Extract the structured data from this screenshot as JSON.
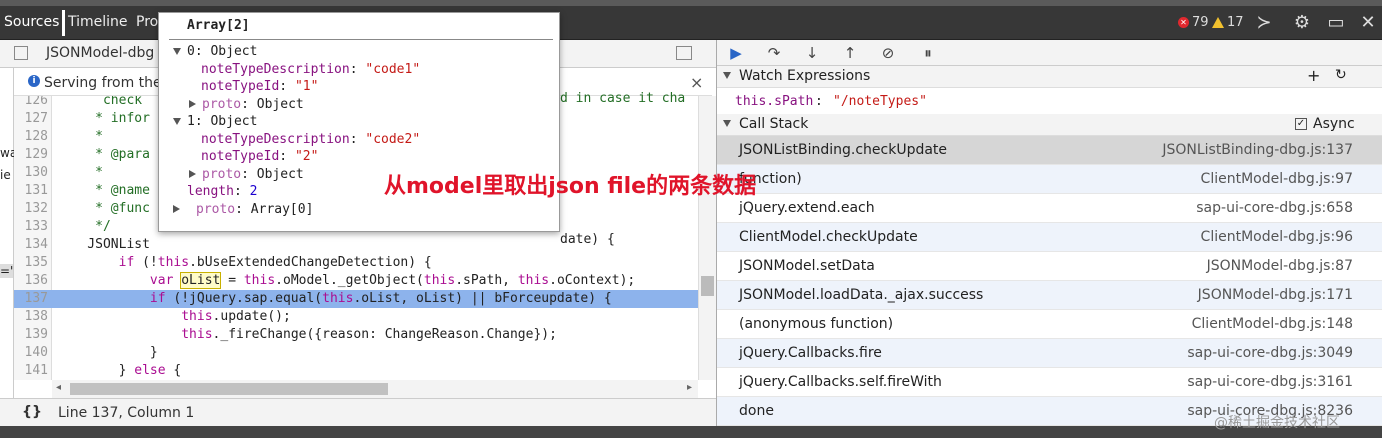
{
  "tabs": {
    "sources": "Sources",
    "timeline": "Timeline",
    "profiles": "Pro"
  },
  "toolbar": {
    "errors": "79",
    "warnings": "17"
  },
  "file_tab": "JSONModel-dbg",
  "info": {
    "text": "Serving from the",
    "close": "×"
  },
  "left_cut": {
    "a": "wa",
    "b": "ie",
    "c": "='"
  },
  "code_lines": [
    {
      "n": "126",
      "html": "      <span class='cm'>check</span>"
    },
    {
      "n": "127",
      "html": "     <span class='cm'>* infor</span>"
    },
    {
      "n": "128",
      "html": "     <span class='cm'>*</span>"
    },
    {
      "n": "129",
      "html": "     <span class='cm'>* @para</span>"
    },
    {
      "n": "130",
      "html": "     <span class='cm'>*</span>"
    },
    {
      "n": "131",
      "html": "     <span class='cm'>* @name</span>"
    },
    {
      "n": "132",
      "html": "     <span class='cm'>* @func</span>"
    },
    {
      "n": "133",
      "html": "     <span class='cm'>*/</span>"
    },
    {
      "n": "134",
      "html": "    JSONList"
    },
    {
      "n": "135",
      "html": "        <span class='kw'>if</span> (!<span class='kw'>this</span>.bUseExtendedChangeDetection) {"
    },
    {
      "n": "136",
      "html": "            <span class='kw'>var</span> <span class='hlbox'>oList</span> = <span class='kw'>this</span>.oModel._getObject(<span class='kw'>this</span>.sPath, <span class='kw'>this</span>.oContext);"
    },
    {
      "n": "137",
      "html": "            <span class='kw'>if</span> (!jQuery.sap.equal(<span class='kw'>this</span>.oList, oList) || bForceupdate) {"
    },
    {
      "n": "138",
      "html": "                <span class='kw'>this</span>.update();"
    },
    {
      "n": "139",
      "html": "                <span class='kw'>this</span>._fireChange({reason: ChangeReason.Change});"
    },
    {
      "n": "140",
      "html": "            }"
    },
    {
      "n": "141",
      "html": "        } <span class='kw'>else</span> {"
    },
    {
      "n": "142",
      "html": ""
    }
  ],
  "code_tail": {
    "l126": "d in case it cha",
    "l134": "date) {"
  },
  "status": {
    "braces": "{}",
    "cursor": "Line 137, Column 1"
  },
  "watch": {
    "title": "Watch Expressions",
    "expr": "this.sPath",
    "value": "\"/noteTypes\""
  },
  "callstack": {
    "title": "Call Stack",
    "async": "Async",
    "frames": [
      {
        "fn": "JSONListBinding.checkUpdate",
        "loc": "JSONListBinding-dbg.js:137"
      },
      {
        "fn": "function)",
        "loc": "ClientModel-dbg.js:97"
      },
      {
        "fn": "jQuery.extend.each",
        "loc": "sap-ui-core-dbg.js:658"
      },
      {
        "fn": "ClientModel.checkUpdate",
        "loc": "ClientModel-dbg.js:96"
      },
      {
        "fn": "JSONModel.setData",
        "loc": "JSONModel-dbg.js:87"
      },
      {
        "fn": "JSONModel.loadData._ajax.success",
        "loc": "JSONModel-dbg.js:171"
      },
      {
        "fn": "(anonymous function)",
        "loc": "ClientModel-dbg.js:148"
      },
      {
        "fn": "jQuery.Callbacks.fire",
        "loc": "sap-ui-core-dbg.js:3049"
      },
      {
        "fn": "jQuery.Callbacks.self.fireWith",
        "loc": "sap-ui-core-dbg.js:3161"
      },
      {
        "fn": "done",
        "loc": "sap-ui-core-dbg.js:8236"
      }
    ]
  },
  "popup": {
    "title": "Array[2]",
    "i0": "0: Object",
    "d0k": "noteTypeDescription",
    "d0v": "\"code1\"",
    "id0k": "noteTypeId",
    "id0v": "\"1\"",
    "p0": "proto",
    "p0t": ": Object",
    "i1": "1: Object",
    "d1k": "noteTypeDescription",
    "d1v": "\"code2\"",
    "id1k": "noteTypeId",
    "id1v": "\"2\"",
    "p1": "proto",
    "p1t": ": Object",
    "lenk": "length",
    "lenv": "2",
    "pa": "proto",
    "pat": ": Array[0]"
  },
  "annotation": "从model里取出json file的两条数据",
  "watermark": "@稀土掘金技术社区",
  "colors": {
    "highlight": "#8db3ec",
    "annotation": "#e0142a",
    "accent": "#2a66c7"
  }
}
